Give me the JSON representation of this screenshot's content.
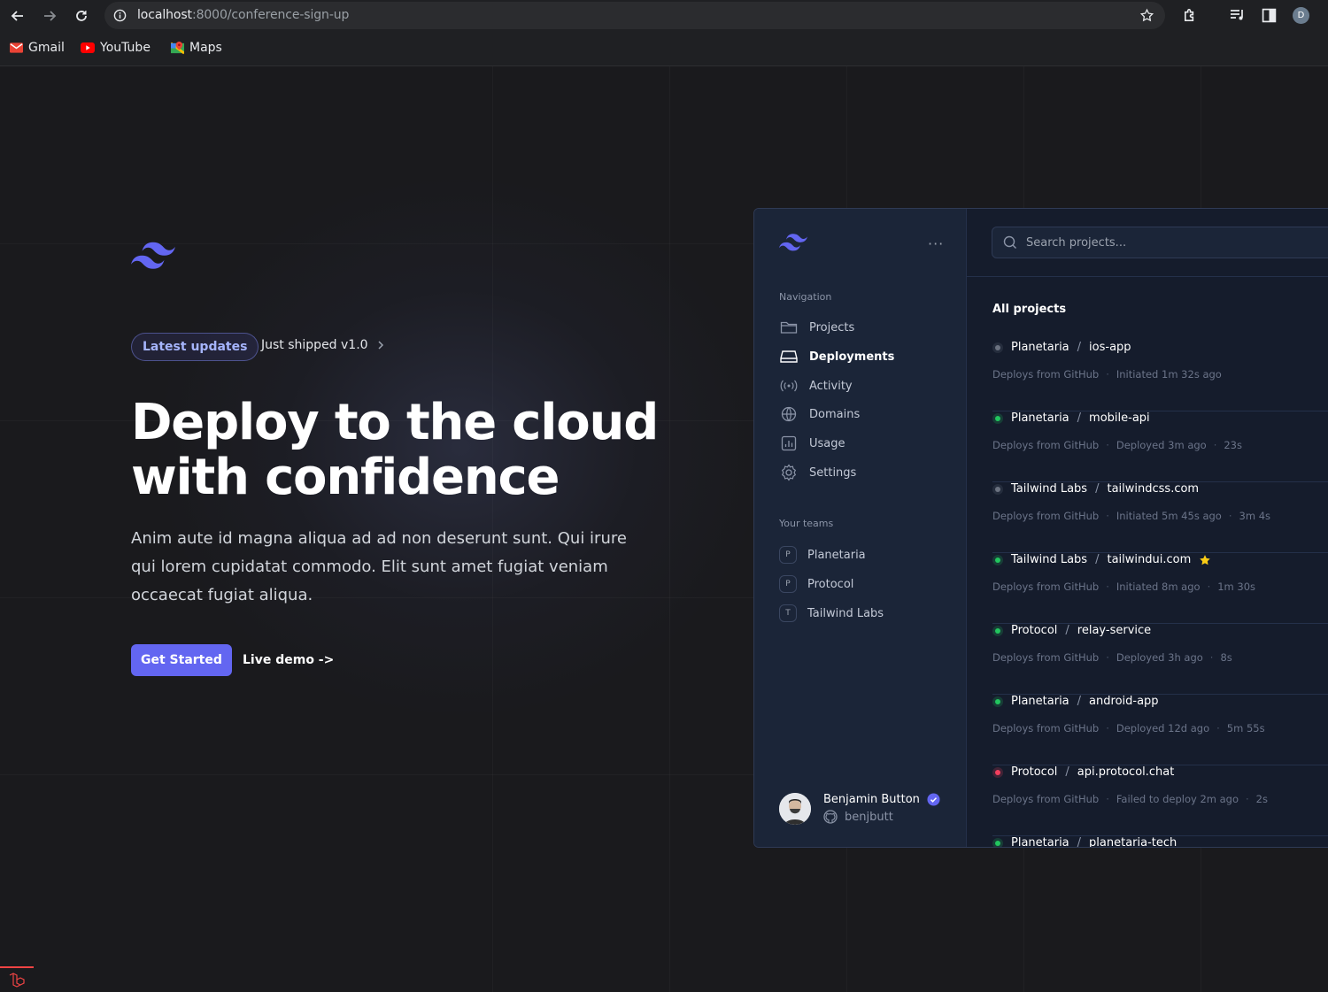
{
  "browser": {
    "url_host": "localhost",
    "url_path": ":8000/conference-sign-up",
    "profile_initial": "D",
    "bookmarks": [
      {
        "label": "Gmail",
        "icon": "gmail-icon"
      },
      {
        "label": "YouTube",
        "icon": "youtube-icon"
      },
      {
        "label": "Maps",
        "icon": "maps-icon"
      }
    ]
  },
  "hero": {
    "badge": "Latest updates",
    "shipped": "Just shipped v1.0",
    "headline_line1": "Deploy to the cloud",
    "headline_line2": "with confidence",
    "lead": "Anim aute id magna aliqua ad ad non deserunt sunt. Qui irure qui lorem cupidatat commodo. Elit sunt amet fugiat veniam occaecat fugiat aliqua.",
    "cta": "Get Started",
    "demo": "Live demo ->",
    "accent": "#6366f1"
  },
  "app": {
    "nav_title": "Navigation",
    "nav": [
      {
        "label": "Projects",
        "icon": "folder-icon",
        "active": false
      },
      {
        "label": "Deployments",
        "icon": "server-icon",
        "active": true
      },
      {
        "label": "Activity",
        "icon": "signal-icon",
        "active": false
      },
      {
        "label": "Domains",
        "icon": "globe-icon",
        "active": false
      },
      {
        "label": "Usage",
        "icon": "chart-icon",
        "active": false
      },
      {
        "label": "Settings",
        "icon": "gear-icon",
        "active": false
      }
    ],
    "teams_title": "Your teams",
    "teams": [
      {
        "initial": "P",
        "label": "Planetaria"
      },
      {
        "initial": "P",
        "label": "Protocol"
      },
      {
        "initial": "T",
        "label": "Tailwind Labs"
      }
    ],
    "user": {
      "name": "Benjamin Button",
      "handle": "benjbutt"
    },
    "search_placeholder": "Search projects...",
    "projects_title": "All projects",
    "projects": [
      {
        "team": "Planetaria",
        "name": "ios-app",
        "status": "gray",
        "source": "Deploys from GitHub",
        "state": "Initiated 1m 32s ago",
        "duration": "",
        "star": false
      },
      {
        "team": "Planetaria",
        "name": "mobile-api",
        "status": "green",
        "source": "Deploys from GitHub",
        "state": "Deployed 3m ago",
        "duration": "23s",
        "star": false
      },
      {
        "team": "Tailwind Labs",
        "name": "tailwindcss.com",
        "status": "gray",
        "source": "Deploys from GitHub",
        "state": "Initiated 5m 45s ago",
        "duration": "3m 4s",
        "star": false
      },
      {
        "team": "Tailwind Labs",
        "name": "tailwindui.com",
        "status": "green",
        "source": "Deploys from GitHub",
        "state": "Initiated 8m ago",
        "duration": "1m 30s",
        "star": true
      },
      {
        "team": "Protocol",
        "name": "relay-service",
        "status": "green",
        "source": "Deploys from GitHub",
        "state": "Deployed 3h ago",
        "duration": "8s",
        "star": false
      },
      {
        "team": "Planetaria",
        "name": "android-app",
        "status": "green",
        "source": "Deploys from GitHub",
        "state": "Deployed 12d ago",
        "duration": "5m 55s",
        "star": false
      },
      {
        "team": "Protocol",
        "name": "api.protocol.chat",
        "status": "red",
        "source": "Deploys from GitHub",
        "state": "Failed to deploy 2m ago",
        "duration": "2s",
        "star": false
      },
      {
        "team": "Planetaria",
        "name": "planetaria-tech",
        "status": "green",
        "source": "",
        "state": "",
        "duration": "",
        "star": false
      }
    ],
    "status_colors": {
      "gray": "#6b7280",
      "green": "#22c55e",
      "red": "#f43f5e"
    }
  }
}
